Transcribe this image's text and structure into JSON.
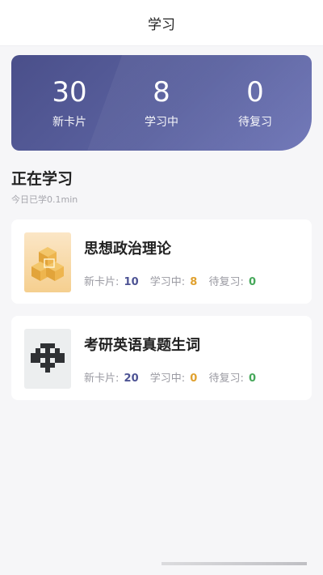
{
  "header": {
    "title": "学习"
  },
  "stats": {
    "new_cards": {
      "value": "30",
      "label": "新卡片"
    },
    "learning": {
      "value": "8",
      "label": "学习中"
    },
    "to_review": {
      "value": "0",
      "label": "待复习"
    }
  },
  "section": {
    "title": "正在学习",
    "subtitle": "今日已学0.1min"
  },
  "courses": [
    {
      "name": "思想政治理论",
      "thumbnail_icon": "cube-stack-icon",
      "new_label": "新卡片:",
      "new_value": "10",
      "learning_label": "学习中:",
      "learning_value": "8",
      "review_label": "待复习:",
      "review_value": "0"
    },
    {
      "name": "考研英语真题生词",
      "thumbnail_icon": "pixel-glyph-icon",
      "new_label": "新卡片:",
      "new_value": "20",
      "learning_label": "学习中:",
      "learning_value": "0",
      "review_label": "待复习:",
      "review_value": "0"
    }
  ],
  "colors": {
    "card_gradient_start": "#4a4f8a",
    "card_gradient_end": "#7178b8",
    "new_value": "#4d5394",
    "learning_value": "#e0a12f",
    "review_value": "#46a85a"
  }
}
